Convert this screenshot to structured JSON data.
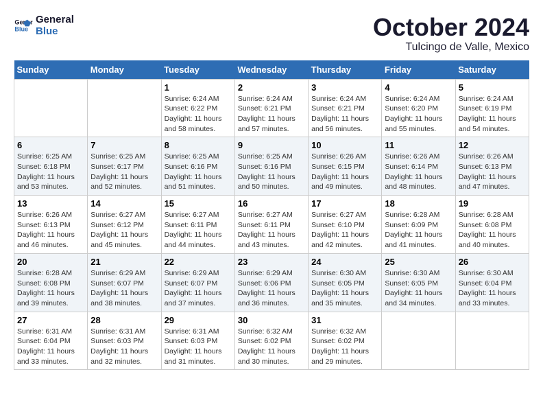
{
  "logo": {
    "line1": "General",
    "line2": "Blue"
  },
  "title": "October 2024",
  "location": "Tulcingo de Valle, Mexico",
  "weekdays": [
    "Sunday",
    "Monday",
    "Tuesday",
    "Wednesday",
    "Thursday",
    "Friday",
    "Saturday"
  ],
  "weeks": [
    [
      {
        "day": "",
        "info": ""
      },
      {
        "day": "",
        "info": ""
      },
      {
        "day": "1",
        "info": "Sunrise: 6:24 AM\nSunset: 6:22 PM\nDaylight: 11 hours and 58 minutes."
      },
      {
        "day": "2",
        "info": "Sunrise: 6:24 AM\nSunset: 6:21 PM\nDaylight: 11 hours and 57 minutes."
      },
      {
        "day": "3",
        "info": "Sunrise: 6:24 AM\nSunset: 6:21 PM\nDaylight: 11 hours and 56 minutes."
      },
      {
        "day": "4",
        "info": "Sunrise: 6:24 AM\nSunset: 6:20 PM\nDaylight: 11 hours and 55 minutes."
      },
      {
        "day": "5",
        "info": "Sunrise: 6:24 AM\nSunset: 6:19 PM\nDaylight: 11 hours and 54 minutes."
      }
    ],
    [
      {
        "day": "6",
        "info": "Sunrise: 6:25 AM\nSunset: 6:18 PM\nDaylight: 11 hours and 53 minutes."
      },
      {
        "day": "7",
        "info": "Sunrise: 6:25 AM\nSunset: 6:17 PM\nDaylight: 11 hours and 52 minutes."
      },
      {
        "day": "8",
        "info": "Sunrise: 6:25 AM\nSunset: 6:16 PM\nDaylight: 11 hours and 51 minutes."
      },
      {
        "day": "9",
        "info": "Sunrise: 6:25 AM\nSunset: 6:16 PM\nDaylight: 11 hours and 50 minutes."
      },
      {
        "day": "10",
        "info": "Sunrise: 6:26 AM\nSunset: 6:15 PM\nDaylight: 11 hours and 49 minutes."
      },
      {
        "day": "11",
        "info": "Sunrise: 6:26 AM\nSunset: 6:14 PM\nDaylight: 11 hours and 48 minutes."
      },
      {
        "day": "12",
        "info": "Sunrise: 6:26 AM\nSunset: 6:13 PM\nDaylight: 11 hours and 47 minutes."
      }
    ],
    [
      {
        "day": "13",
        "info": "Sunrise: 6:26 AM\nSunset: 6:13 PM\nDaylight: 11 hours and 46 minutes."
      },
      {
        "day": "14",
        "info": "Sunrise: 6:27 AM\nSunset: 6:12 PM\nDaylight: 11 hours and 45 minutes."
      },
      {
        "day": "15",
        "info": "Sunrise: 6:27 AM\nSunset: 6:11 PM\nDaylight: 11 hours and 44 minutes."
      },
      {
        "day": "16",
        "info": "Sunrise: 6:27 AM\nSunset: 6:11 PM\nDaylight: 11 hours and 43 minutes."
      },
      {
        "day": "17",
        "info": "Sunrise: 6:27 AM\nSunset: 6:10 PM\nDaylight: 11 hours and 42 minutes."
      },
      {
        "day": "18",
        "info": "Sunrise: 6:28 AM\nSunset: 6:09 PM\nDaylight: 11 hours and 41 minutes."
      },
      {
        "day": "19",
        "info": "Sunrise: 6:28 AM\nSunset: 6:08 PM\nDaylight: 11 hours and 40 minutes."
      }
    ],
    [
      {
        "day": "20",
        "info": "Sunrise: 6:28 AM\nSunset: 6:08 PM\nDaylight: 11 hours and 39 minutes."
      },
      {
        "day": "21",
        "info": "Sunrise: 6:29 AM\nSunset: 6:07 PM\nDaylight: 11 hours and 38 minutes."
      },
      {
        "day": "22",
        "info": "Sunrise: 6:29 AM\nSunset: 6:07 PM\nDaylight: 11 hours and 37 minutes."
      },
      {
        "day": "23",
        "info": "Sunrise: 6:29 AM\nSunset: 6:06 PM\nDaylight: 11 hours and 36 minutes."
      },
      {
        "day": "24",
        "info": "Sunrise: 6:30 AM\nSunset: 6:05 PM\nDaylight: 11 hours and 35 minutes."
      },
      {
        "day": "25",
        "info": "Sunrise: 6:30 AM\nSunset: 6:05 PM\nDaylight: 11 hours and 34 minutes."
      },
      {
        "day": "26",
        "info": "Sunrise: 6:30 AM\nSunset: 6:04 PM\nDaylight: 11 hours and 33 minutes."
      }
    ],
    [
      {
        "day": "27",
        "info": "Sunrise: 6:31 AM\nSunset: 6:04 PM\nDaylight: 11 hours and 33 minutes."
      },
      {
        "day": "28",
        "info": "Sunrise: 6:31 AM\nSunset: 6:03 PM\nDaylight: 11 hours and 32 minutes."
      },
      {
        "day": "29",
        "info": "Sunrise: 6:31 AM\nSunset: 6:03 PM\nDaylight: 11 hours and 31 minutes."
      },
      {
        "day": "30",
        "info": "Sunrise: 6:32 AM\nSunset: 6:02 PM\nDaylight: 11 hours and 30 minutes."
      },
      {
        "day": "31",
        "info": "Sunrise: 6:32 AM\nSunset: 6:02 PM\nDaylight: 11 hours and 29 minutes."
      },
      {
        "day": "",
        "info": ""
      },
      {
        "day": "",
        "info": ""
      }
    ]
  ]
}
